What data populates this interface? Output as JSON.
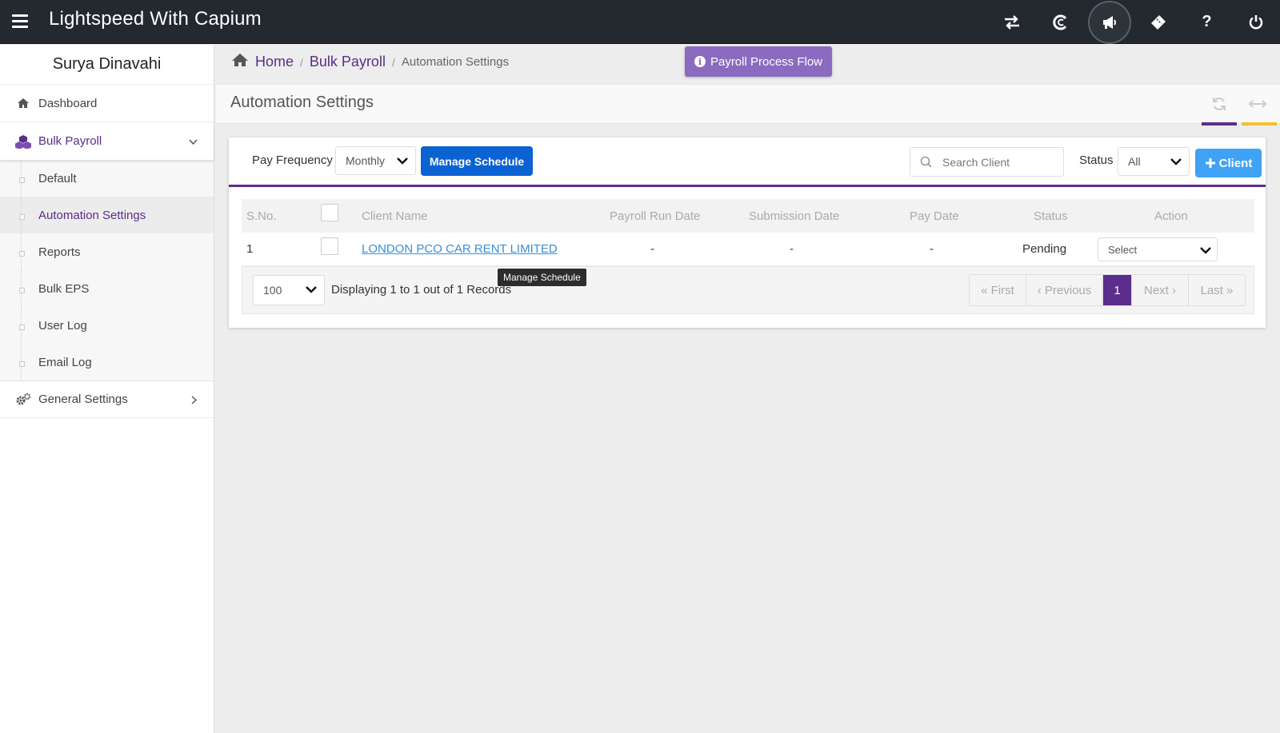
{
  "app": {
    "title": "Lightspeed With Capium"
  },
  "topbar": {
    "icons": [
      "transfer-icon",
      "capium-icon",
      "megaphone-icon",
      "ticket-icon",
      "help-icon",
      "power-icon"
    ]
  },
  "sidebar": {
    "user_name": "Surya Dinavahi",
    "dashboard": "Dashboard",
    "bulk_payroll": "Bulk Payroll",
    "sub_items": [
      "Default",
      "Automation Settings",
      "Reports",
      "Bulk EPS",
      "User Log",
      "Email Log"
    ],
    "general_settings": "General Settings"
  },
  "breadcrumb": {
    "home": "Home",
    "bulk_payroll": "Bulk Payroll",
    "current": "Automation Settings"
  },
  "flow_button": {
    "label": "Payroll Process Flow"
  },
  "page": {
    "title": "Automation Settings",
    "accent_purple": "#5b2d8c",
    "accent_yellow": "#f2c12e"
  },
  "toolbar": {
    "pay_frequency_label": "Pay Frequency",
    "pay_frequency_value": "Monthly",
    "manage_schedule": "Manage Schedule",
    "search_placeholder": "Search Client",
    "status_label": "Status",
    "status_value": "All",
    "add_client": "Client"
  },
  "table": {
    "headers": {
      "sno": "S.No.",
      "client_name": "Client Name",
      "payroll_run_date": "Payroll Run Date",
      "submission_date": "Submission Date",
      "pay_date": "Pay Date",
      "status": "Status",
      "action": "Action"
    },
    "rows": [
      {
        "sno": "1",
        "client_name": "LONDON PCO CAR RENT LIMITED",
        "payroll_run_date": "-",
        "submission_date": "-",
        "pay_date": "-",
        "status": "Pending",
        "action": "Select"
      }
    ]
  },
  "footer": {
    "page_size": "100",
    "displaying": "Displaying 1 to 1 out of 1 Records",
    "first": "« First",
    "previous": "‹ Previous",
    "current_page": "1",
    "next": "Next ›",
    "last": "Last »"
  },
  "tooltip": {
    "text": "Manage Schedule"
  }
}
